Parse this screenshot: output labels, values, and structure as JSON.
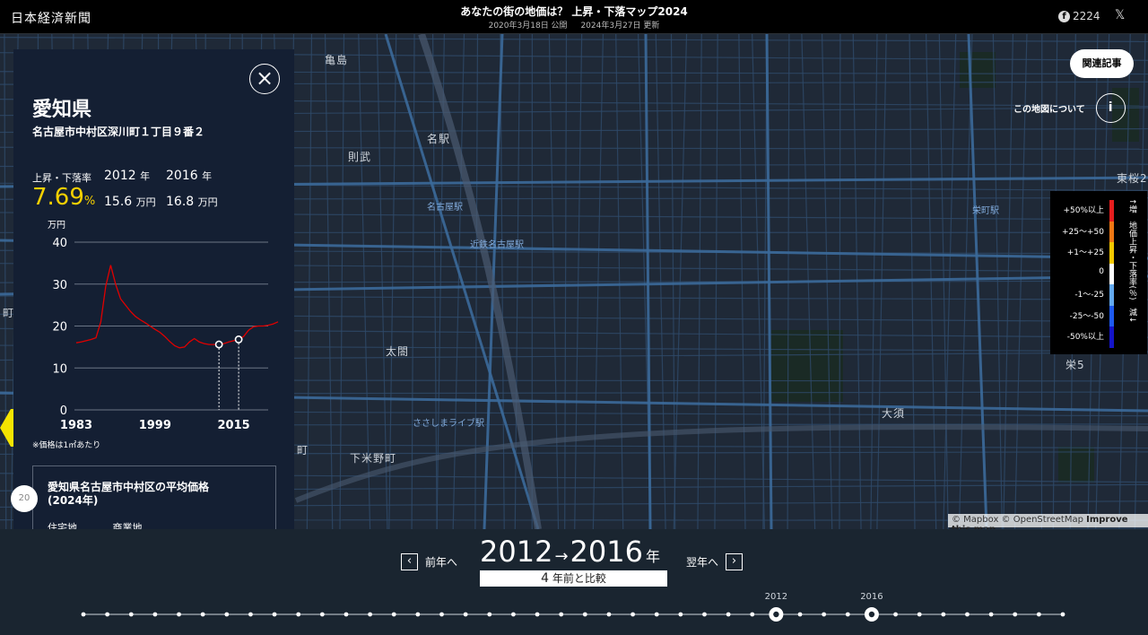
{
  "header": {
    "logo": "日本経済新聞",
    "title": "あなたの街の地価は？ 上昇・下落マップ2024",
    "published": "2020年3月18日 公開",
    "updated": "2024年3月27日 更新",
    "facebook_count": "2224",
    "x_icon": "x-logo-icon"
  },
  "map": {
    "place_labels": [
      {
        "text": "亀島"
      },
      {
        "text": "名駅"
      },
      {
        "text": "則武"
      },
      {
        "text": "太閤"
      },
      {
        "text": "下米野町"
      },
      {
        "text": "大須"
      },
      {
        "text": "東桜2"
      },
      {
        "text": "栄5"
      },
      {
        "text": "町"
      },
      {
        "text": "町"
      }
    ],
    "station_labels": [
      {
        "text": "名古屋駅"
      },
      {
        "text": "近鉄名古屋駅"
      },
      {
        "text": "ささしまライブ駅"
      },
      {
        "text": "栄町駅"
      }
    ],
    "related_button": "関連記事",
    "about_label": "この地図について",
    "about_icon": "i",
    "attribution": {
      "mapbox": "© Mapbox",
      "osm": "© OpenStreetMap",
      "improve": "Improve this map"
    },
    "hex_color": "#f5e400"
  },
  "legend": {
    "title": "↑増　地価上昇・下落率(％)　減↓",
    "rows": [
      {
        "label": "+50%以上",
        "color": "#e61e1e"
      },
      {
        "label": "+25〜+50",
        "color": "#f07814"
      },
      {
        "label": "+1〜+25",
        "color": "#f5c800"
      },
      {
        "label": "0",
        "color": "#ffffff"
      },
      {
        "label": "-1〜-25",
        "color": "#64aaf0"
      },
      {
        "label": "-25〜-50",
        "color": "#1e5af0"
      },
      {
        "label": "-50%以上",
        "color": "#1414c8"
      }
    ]
  },
  "panel": {
    "close_icon": "×",
    "prefecture": "愛知県",
    "address": "名古屋市中村区深川町１丁目９番２",
    "rate_label": "上昇・下落率",
    "year1": "2012",
    "year2": "2016",
    "year_unit": "年",
    "rate_value": "7.69",
    "rate_unit": "%",
    "price1": "15.6",
    "price2": "16.8",
    "price_unit": "万円",
    "note": "※価格は1㎡あたり",
    "avg_title": "愛知県名古屋市中村区の平均価格(2024年)",
    "avg_col1": "住宅地",
    "avg_col2": "商業地",
    "side_badge": "20"
  },
  "chart_data": {
    "type": "line",
    "ylabel": "万円",
    "ylim": [
      0,
      40
    ],
    "yticks": [
      "0",
      "10",
      "20",
      "30",
      "40"
    ],
    "xticks": [
      "1983",
      "1999",
      "2015"
    ],
    "xlim": [
      1983,
      2024
    ],
    "series": [
      {
        "color": "#e00000",
        "x": [
          1983,
          1984,
          1985,
          1986,
          1987,
          1988,
          1989,
          1990,
          1991,
          1992,
          1993,
          1994,
          1995,
          1996,
          1997,
          1998,
          1999,
          2000,
          2001,
          2002,
          2003,
          2004,
          2005,
          2006,
          2007,
          2008,
          2009,
          2010,
          2011,
          2012,
          2013,
          2014,
          2015,
          2016,
          2017,
          2018,
          2019,
          2020,
          2021,
          2022,
          2023,
          2024
        ],
        "y": [
          16.0,
          16.2,
          16.5,
          16.8,
          17.2,
          21.0,
          29.5,
          34.5,
          30.0,
          26.5,
          25.0,
          23.5,
          22.3,
          21.5,
          20.8,
          20.0,
          19.2,
          18.5,
          17.5,
          16.3,
          15.3,
          14.8,
          15.0,
          16.2,
          17.0,
          16.2,
          15.8,
          15.6,
          15.6,
          15.6,
          15.8,
          16.2,
          16.5,
          16.8,
          17.5,
          19.0,
          19.8,
          20.0,
          20.0,
          20.2,
          20.5,
          21.0
        ]
      }
    ],
    "markers": [
      {
        "x": 2012,
        "y": 15.6
      },
      {
        "x": 2016,
        "y": 16.8
      }
    ]
  },
  "bottom": {
    "prev_label": "前年へ",
    "next_label": "翌年へ",
    "from_year": "2012",
    "to_year": "2016",
    "year_unit": "年",
    "arrow": "→",
    "compare_prefix": "4",
    "compare_suffix": "年前と比較",
    "timeline": {
      "start": 1983,
      "end": 2024,
      "selected": [
        2012,
        2016
      ],
      "labels": [
        "2012",
        "2016"
      ]
    }
  }
}
